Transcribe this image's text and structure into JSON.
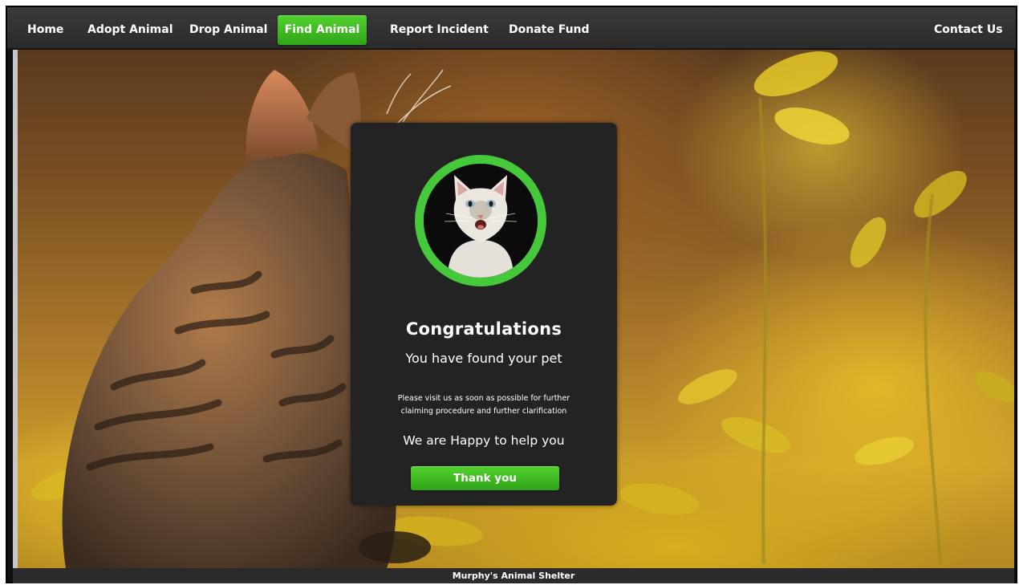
{
  "nav": {
    "items": [
      {
        "label": "Home"
      },
      {
        "label": "Adopt Animal"
      },
      {
        "label": "Drop Animal"
      },
      {
        "label": "Find Animal",
        "active": true
      },
      {
        "label": "Report Incident"
      },
      {
        "label": "Donate Fund"
      },
      {
        "label": "Contact Us"
      }
    ]
  },
  "modal": {
    "title": "Congratulations",
    "subtitle": "You have found your pet",
    "message_line1": "Please visit us as soon as possible for further",
    "message_line2": "claiming procedure and further clarification",
    "help_text": "We are Happy to help you",
    "button_label": "Thank you",
    "avatar_icon": "cat-photo"
  },
  "footer": {
    "text": "Murphy's Animal Shelter"
  },
  "colors": {
    "accent_green": "#45c93a",
    "nav_background": "#333333",
    "modal_background": "#232323"
  }
}
